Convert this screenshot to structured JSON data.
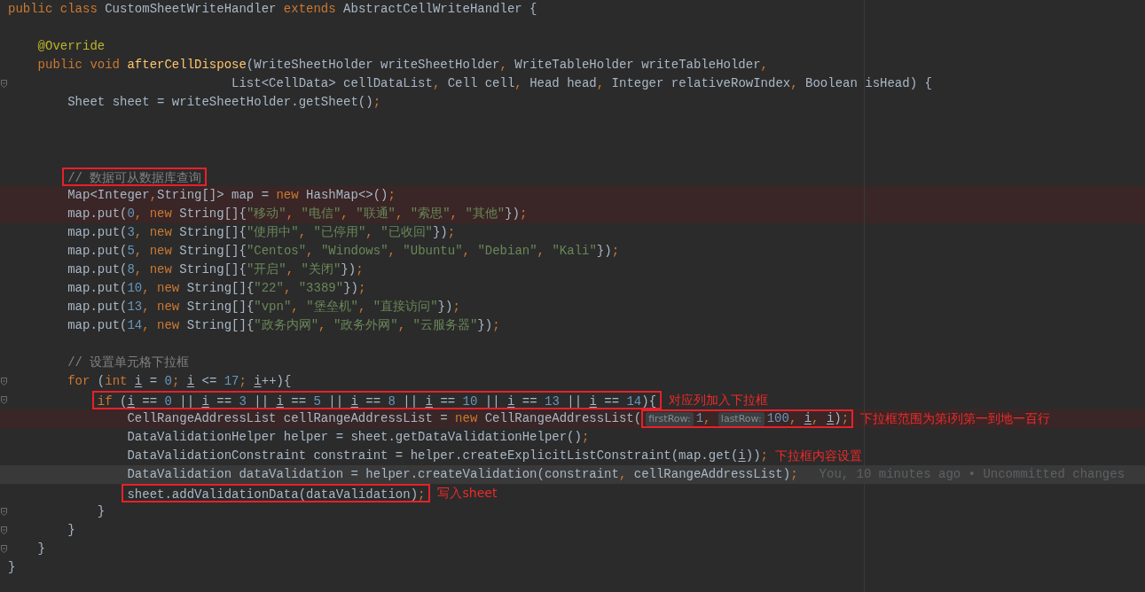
{
  "editor": {
    "lines": [
      {
        "error": false,
        "current": false,
        "fold": false,
        "segments": [
          {
            "kind": "code",
            "tokens": [
              {
                "kind": "keyword",
                "text": "public class "
              },
              {
                "kind": "plain",
                "text": "CustomSheetWriteHandler "
              },
              {
                "kind": "keyword",
                "text": "extends "
              },
              {
                "kind": "plain",
                "text": "AbstractCellWriteHandler {"
              }
            ]
          }
        ]
      },
      {
        "error": false,
        "current": false,
        "fold": false
      },
      {
        "error": false,
        "current": false,
        "fold": false,
        "segments": [
          {
            "kind": "code",
            "tokens": [
              {
                "kind": "annotation",
                "text": "    @Override"
              }
            ]
          }
        ]
      },
      {
        "error": false,
        "current": false,
        "fold": false,
        "segments": [
          {
            "kind": "code",
            "tokens": [
              {
                "kind": "keyword",
                "text": "    public void "
              },
              {
                "kind": "method",
                "text": "afterCellDispose"
              },
              {
                "kind": "plain",
                "text": "(WriteSheetHolder writeSheetHolder"
              },
              {
                "kind": "keyword",
                "text": ", "
              },
              {
                "kind": "plain",
                "text": "WriteTableHolder writeTableHolder"
              },
              {
                "kind": "keyword",
                "text": ","
              }
            ]
          }
        ]
      },
      {
        "error": false,
        "current": false,
        "fold": true,
        "segments": [
          {
            "kind": "code",
            "tokens": [
              {
                "kind": "plain",
                "text": "                              List<CellData> cellDataList"
              },
              {
                "kind": "keyword",
                "text": ", "
              },
              {
                "kind": "plain",
                "text": "Cell cell"
              },
              {
                "kind": "keyword",
                "text": ", "
              },
              {
                "kind": "plain",
                "text": "Head head"
              },
              {
                "kind": "keyword",
                "text": ", "
              },
              {
                "kind": "plain",
                "text": "Integer relativeRowIndex"
              },
              {
                "kind": "keyword",
                "text": ", "
              },
              {
                "kind": "plain",
                "text": "Boolean isHead) {"
              }
            ]
          }
        ]
      },
      {
        "error": false,
        "current": false,
        "fold": false,
        "segments": [
          {
            "kind": "code",
            "tokens": [
              {
                "kind": "plain",
                "text": "        Sheet sheet = writeSheetHolder.getSheet()"
              },
              {
                "kind": "keyword",
                "text": ";"
              }
            ]
          }
        ]
      },
      {
        "error": false,
        "current": false,
        "fold": false
      },
      {
        "error": false,
        "current": false,
        "fold": false
      },
      {
        "error": false,
        "current": false,
        "fold": false
      },
      {
        "error": false,
        "current": false,
        "fold": false,
        "segments": [
          {
            "kind": "box",
            "children": [
              {
                "kind": "code",
                "tokens": [
                  {
                    "kind": "comment",
                    "text": "        // 数据可从数据库查询"
                  }
                ]
              }
            ]
          }
        ]
      },
      {
        "error": true,
        "current": false,
        "fold": false,
        "segments": [
          {
            "kind": "code",
            "tokens": [
              {
                "kind": "plain",
                "text": "        Map<Integer"
              },
              {
                "kind": "keyword",
                "text": ","
              },
              {
                "kind": "plain",
                "text": "String[]> map = "
              },
              {
                "kind": "keyword",
                "text": "new "
              },
              {
                "kind": "plain",
                "text": "HashMap<>()"
              },
              {
                "kind": "keyword",
                "text": ";"
              }
            ]
          }
        ]
      },
      {
        "error": true,
        "current": false,
        "fold": false,
        "segments": [
          {
            "kind": "code",
            "tokens": [
              {
                "kind": "plain",
                "text": "        map.put("
              },
              {
                "kind": "number",
                "text": "0"
              },
              {
                "kind": "keyword",
                "text": ", new "
              },
              {
                "kind": "plain",
                "text": "String[]{"
              },
              {
                "kind": "string",
                "text": "\"移动\""
              },
              {
                "kind": "keyword",
                "text": ", "
              },
              {
                "kind": "string",
                "text": "\"电信\""
              },
              {
                "kind": "keyword",
                "text": ", "
              },
              {
                "kind": "string",
                "text": "\"联通\""
              },
              {
                "kind": "keyword",
                "text": ", "
              },
              {
                "kind": "string",
                "text": "\"索思\""
              },
              {
                "kind": "keyword",
                "text": ", "
              },
              {
                "kind": "string",
                "text": "\"其他\""
              },
              {
                "kind": "plain",
                "text": "})"
              },
              {
                "kind": "keyword",
                "text": ";"
              }
            ]
          }
        ]
      },
      {
        "error": false,
        "current": false,
        "fold": false,
        "segments": [
          {
            "kind": "code",
            "tokens": [
              {
                "kind": "plain",
                "text": "        map.put("
              },
              {
                "kind": "number",
                "text": "3"
              },
              {
                "kind": "keyword",
                "text": ", new "
              },
              {
                "kind": "plain",
                "text": "String[]{"
              },
              {
                "kind": "string",
                "text": "\"使用中\""
              },
              {
                "kind": "keyword",
                "text": ", "
              },
              {
                "kind": "string",
                "text": "\"已停用\""
              },
              {
                "kind": "keyword",
                "text": ", "
              },
              {
                "kind": "string",
                "text": "\"已收回\""
              },
              {
                "kind": "plain",
                "text": "})"
              },
              {
                "kind": "keyword",
                "text": ";"
              }
            ]
          }
        ]
      },
      {
        "error": false,
        "current": false,
        "fold": false,
        "segments": [
          {
            "kind": "code",
            "tokens": [
              {
                "kind": "plain",
                "text": "        map.put("
              },
              {
                "kind": "number",
                "text": "5"
              },
              {
                "kind": "keyword",
                "text": ", new "
              },
              {
                "kind": "plain",
                "text": "String[]{"
              },
              {
                "kind": "string",
                "text": "\"Centos\""
              },
              {
                "kind": "keyword",
                "text": ", "
              },
              {
                "kind": "string",
                "text": "\"Windows\""
              },
              {
                "kind": "keyword",
                "text": ", "
              },
              {
                "kind": "string",
                "text": "\"Ubuntu\""
              },
              {
                "kind": "keyword",
                "text": ", "
              },
              {
                "kind": "string",
                "text": "\"Debian\""
              },
              {
                "kind": "keyword",
                "text": ", "
              },
              {
                "kind": "string",
                "text": "\"Kali\""
              },
              {
                "kind": "plain",
                "text": "})"
              },
              {
                "kind": "keyword",
                "text": ";"
              }
            ]
          }
        ]
      },
      {
        "error": false,
        "current": false,
        "fold": false,
        "segments": [
          {
            "kind": "code",
            "tokens": [
              {
                "kind": "plain",
                "text": "        map.put("
              },
              {
                "kind": "number",
                "text": "8"
              },
              {
                "kind": "keyword",
                "text": ", new "
              },
              {
                "kind": "plain",
                "text": "String[]{"
              },
              {
                "kind": "string",
                "text": "\"开启\""
              },
              {
                "kind": "keyword",
                "text": ", "
              },
              {
                "kind": "string",
                "text": "\"关闭\""
              },
              {
                "kind": "plain",
                "text": "})"
              },
              {
                "kind": "keyword",
                "text": ";"
              }
            ]
          }
        ]
      },
      {
        "error": false,
        "current": false,
        "fold": false,
        "segments": [
          {
            "kind": "code",
            "tokens": [
              {
                "kind": "plain",
                "text": "        map.put("
              },
              {
                "kind": "number",
                "text": "10"
              },
              {
                "kind": "keyword",
                "text": ", new "
              },
              {
                "kind": "plain",
                "text": "String[]{"
              },
              {
                "kind": "string",
                "text": "\"22\""
              },
              {
                "kind": "keyword",
                "text": ", "
              },
              {
                "kind": "string",
                "text": "\"3389\""
              },
              {
                "kind": "plain",
                "text": "})"
              },
              {
                "kind": "keyword",
                "text": ";"
              }
            ]
          }
        ]
      },
      {
        "error": false,
        "current": false,
        "fold": false,
        "segments": [
          {
            "kind": "code",
            "tokens": [
              {
                "kind": "plain",
                "text": "        map.put("
              },
              {
                "kind": "number",
                "text": "13"
              },
              {
                "kind": "keyword",
                "text": ", new "
              },
              {
                "kind": "plain",
                "text": "String[]{"
              },
              {
                "kind": "string",
                "text": "\"vpn\""
              },
              {
                "kind": "keyword",
                "text": ", "
              },
              {
                "kind": "string",
                "text": "\"堡垒机\""
              },
              {
                "kind": "keyword",
                "text": ", "
              },
              {
                "kind": "string",
                "text": "\"直接访问\""
              },
              {
                "kind": "plain",
                "text": "})"
              },
              {
                "kind": "keyword",
                "text": ";"
              }
            ]
          }
        ]
      },
      {
        "error": false,
        "current": false,
        "fold": false,
        "segments": [
          {
            "kind": "code",
            "tokens": [
              {
                "kind": "plain",
                "text": "        map.put("
              },
              {
                "kind": "number",
                "text": "14"
              },
              {
                "kind": "keyword",
                "text": ", new "
              },
              {
                "kind": "plain",
                "text": "String[]{"
              },
              {
                "kind": "string",
                "text": "\"政务内网\""
              },
              {
                "kind": "keyword",
                "text": ", "
              },
              {
                "kind": "string",
                "text": "\"政务外网\""
              },
              {
                "kind": "keyword",
                "text": ", "
              },
              {
                "kind": "string",
                "text": "\"云服务器\""
              },
              {
                "kind": "plain",
                "text": "})"
              },
              {
                "kind": "keyword",
                "text": ";"
              }
            ]
          }
        ]
      },
      {
        "error": false,
        "current": false,
        "fold": false
      },
      {
        "error": false,
        "current": false,
        "fold": false,
        "segments": [
          {
            "kind": "code",
            "tokens": [
              {
                "kind": "comment",
                "text": "        // 设置单元格下拉框"
              }
            ]
          }
        ]
      },
      {
        "error": false,
        "current": false,
        "fold": true,
        "segments": [
          {
            "kind": "code",
            "tokens": [
              {
                "kind": "keyword",
                "text": "        for "
              },
              {
                "kind": "plain",
                "text": "("
              },
              {
                "kind": "keyword",
                "text": "int "
              },
              {
                "kind": "variable",
                "text": "i"
              },
              {
                "kind": "plain",
                "text": " = "
              },
              {
                "kind": "number",
                "text": "0"
              },
              {
                "kind": "keyword",
                "text": "; "
              },
              {
                "kind": "variable",
                "text": "i"
              },
              {
                "kind": "plain",
                "text": " <= "
              },
              {
                "kind": "number",
                "text": "17"
              },
              {
                "kind": "keyword",
                "text": "; "
              },
              {
                "kind": "variable",
                "text": "i"
              },
              {
                "kind": "plain",
                "text": "++){"
              }
            ]
          }
        ]
      },
      {
        "error": false,
        "current": false,
        "fold": true,
        "segments": [
          {
            "kind": "box",
            "children": [
              {
                "kind": "code",
                "tokens": [
                  {
                    "kind": "keyword",
                    "text": "            if "
                  },
                  {
                    "kind": "plain",
                    "text": "("
                  },
                  {
                    "kind": "variable",
                    "text": "i"
                  },
                  {
                    "kind": "plain",
                    "text": " == "
                  },
                  {
                    "kind": "number",
                    "text": "0"
                  },
                  {
                    "kind": "plain",
                    "text": " || "
                  },
                  {
                    "kind": "variable",
                    "text": "i"
                  },
                  {
                    "kind": "plain",
                    "text": " == "
                  },
                  {
                    "kind": "number",
                    "text": "3"
                  },
                  {
                    "kind": "plain",
                    "text": " || "
                  },
                  {
                    "kind": "variable",
                    "text": "i"
                  },
                  {
                    "kind": "plain",
                    "text": " == "
                  },
                  {
                    "kind": "number",
                    "text": "5"
                  },
                  {
                    "kind": "plain",
                    "text": " || "
                  },
                  {
                    "kind": "variable",
                    "text": "i"
                  },
                  {
                    "kind": "plain",
                    "text": " == "
                  },
                  {
                    "kind": "number",
                    "text": "8"
                  },
                  {
                    "kind": "plain",
                    "text": " || "
                  },
                  {
                    "kind": "variable",
                    "text": "i"
                  },
                  {
                    "kind": "plain",
                    "text": " == "
                  },
                  {
                    "kind": "number",
                    "text": "10"
                  },
                  {
                    "kind": "plain",
                    "text": " || "
                  },
                  {
                    "kind": "variable",
                    "text": "i"
                  },
                  {
                    "kind": "plain",
                    "text": " == "
                  },
                  {
                    "kind": "number",
                    "text": "13"
                  },
                  {
                    "kind": "plain",
                    "text": " || "
                  },
                  {
                    "kind": "variable",
                    "text": "i"
                  },
                  {
                    "kind": "plain",
                    "text": " == "
                  },
                  {
                    "kind": "number",
                    "text": "14"
                  },
                  {
                    "kind": "plain",
                    "text": "){"
                  }
                ]
              }
            ]
          },
          {
            "kind": "note",
            "text": "对应列加入下拉框"
          }
        ]
      },
      {
        "error": true,
        "current": false,
        "fold": false,
        "segments": [
          {
            "kind": "code",
            "tokens": [
              {
                "kind": "plain",
                "text": "                CellRangeAddressList cellRangeAddressList = "
              },
              {
                "kind": "keyword",
                "text": "new "
              },
              {
                "kind": "plain",
                "text": "CellRangeAddressList("
              }
            ]
          },
          {
            "kind": "box",
            "children": [
              {
                "kind": "hint",
                "text": "firstRow:"
              },
              {
                "kind": "code",
                "tokens": [
                  {
                    "kind": "number",
                    "text": "1"
                  },
                  {
                    "kind": "keyword",
                    "text": ", "
                  }
                ]
              },
              {
                "kind": "hint",
                "text": "lastRow:"
              },
              {
                "kind": "code",
                "tokens": [
                  {
                    "kind": "number",
                    "text": "100"
                  },
                  {
                    "kind": "keyword",
                    "text": ", "
                  },
                  {
                    "kind": "variable",
                    "text": "i"
                  },
                  {
                    "kind": "keyword",
                    "text": ", "
                  },
                  {
                    "kind": "variable",
                    "text": "i"
                  },
                  {
                    "kind": "plain",
                    "text": ")"
                  },
                  {
                    "kind": "keyword",
                    "text": ";"
                  }
                ]
              }
            ]
          },
          {
            "kind": "note",
            "text": "下拉框范围为第i列第一到地一百行"
          }
        ]
      },
      {
        "error": false,
        "current": false,
        "fold": false,
        "segments": [
          {
            "kind": "code",
            "tokens": [
              {
                "kind": "plain",
                "text": "                DataValidationHelper helper = sheet.getDataValidationHelper()"
              },
              {
                "kind": "keyword",
                "text": ";"
              }
            ]
          }
        ]
      },
      {
        "error": false,
        "current": false,
        "fold": false,
        "segments": [
          {
            "kind": "code",
            "tokens": [
              {
                "kind": "plain",
                "text": "                DataValidationConstraint constraint = helper.createExplicitListConstraint(map.get("
              },
              {
                "kind": "variable",
                "text": "i"
              },
              {
                "kind": "plain",
                "text": "))"
              },
              {
                "kind": "keyword",
                "text": ";"
              }
            ]
          },
          {
            "kind": "note",
            "text": "下拉框内容设置"
          }
        ]
      },
      {
        "error": false,
        "current": true,
        "fold": false,
        "segments": [
          {
            "kind": "code",
            "tokens": [
              {
                "kind": "plain",
                "text": "                DataValidation dataValidation = helper.createValidation(constraint"
              },
              {
                "kind": "keyword",
                "text": ", "
              },
              {
                "kind": "plain",
                "text": "cellRangeAddressList)"
              },
              {
                "kind": "keyword",
                "text": ";"
              }
            ]
          },
          {
            "kind": "blame",
            "text": "You, 10 minutes ago • Uncommitted changes"
          }
        ]
      },
      {
        "error": false,
        "current": false,
        "fold": false,
        "segments": [
          {
            "kind": "box",
            "children": [
              {
                "kind": "code",
                "tokens": [
                  {
                    "kind": "plain",
                    "text": "                sheet.addValidationData(dataValidation)"
                  },
                  {
                    "kind": "keyword",
                    "text": ";"
                  }
                ]
              }
            ]
          },
          {
            "kind": "note",
            "text": "写入sheet"
          }
        ]
      },
      {
        "error": false,
        "current": false,
        "fold": true,
        "segments": [
          {
            "kind": "code",
            "tokens": [
              {
                "kind": "plain",
                "text": "            }"
              }
            ]
          }
        ]
      },
      {
        "error": false,
        "current": false,
        "fold": true,
        "segments": [
          {
            "kind": "code",
            "tokens": [
              {
                "kind": "plain",
                "text": "        }"
              }
            ]
          }
        ]
      },
      {
        "error": false,
        "current": false,
        "fold": true,
        "segments": [
          {
            "kind": "code",
            "tokens": [
              {
                "kind": "plain",
                "text": "    }"
              }
            ]
          }
        ]
      },
      {
        "error": false,
        "current": false,
        "fold": false,
        "segments": [
          {
            "kind": "code",
            "tokens": [
              {
                "kind": "plain",
                "text": "}"
              }
            ]
          }
        ]
      }
    ]
  }
}
